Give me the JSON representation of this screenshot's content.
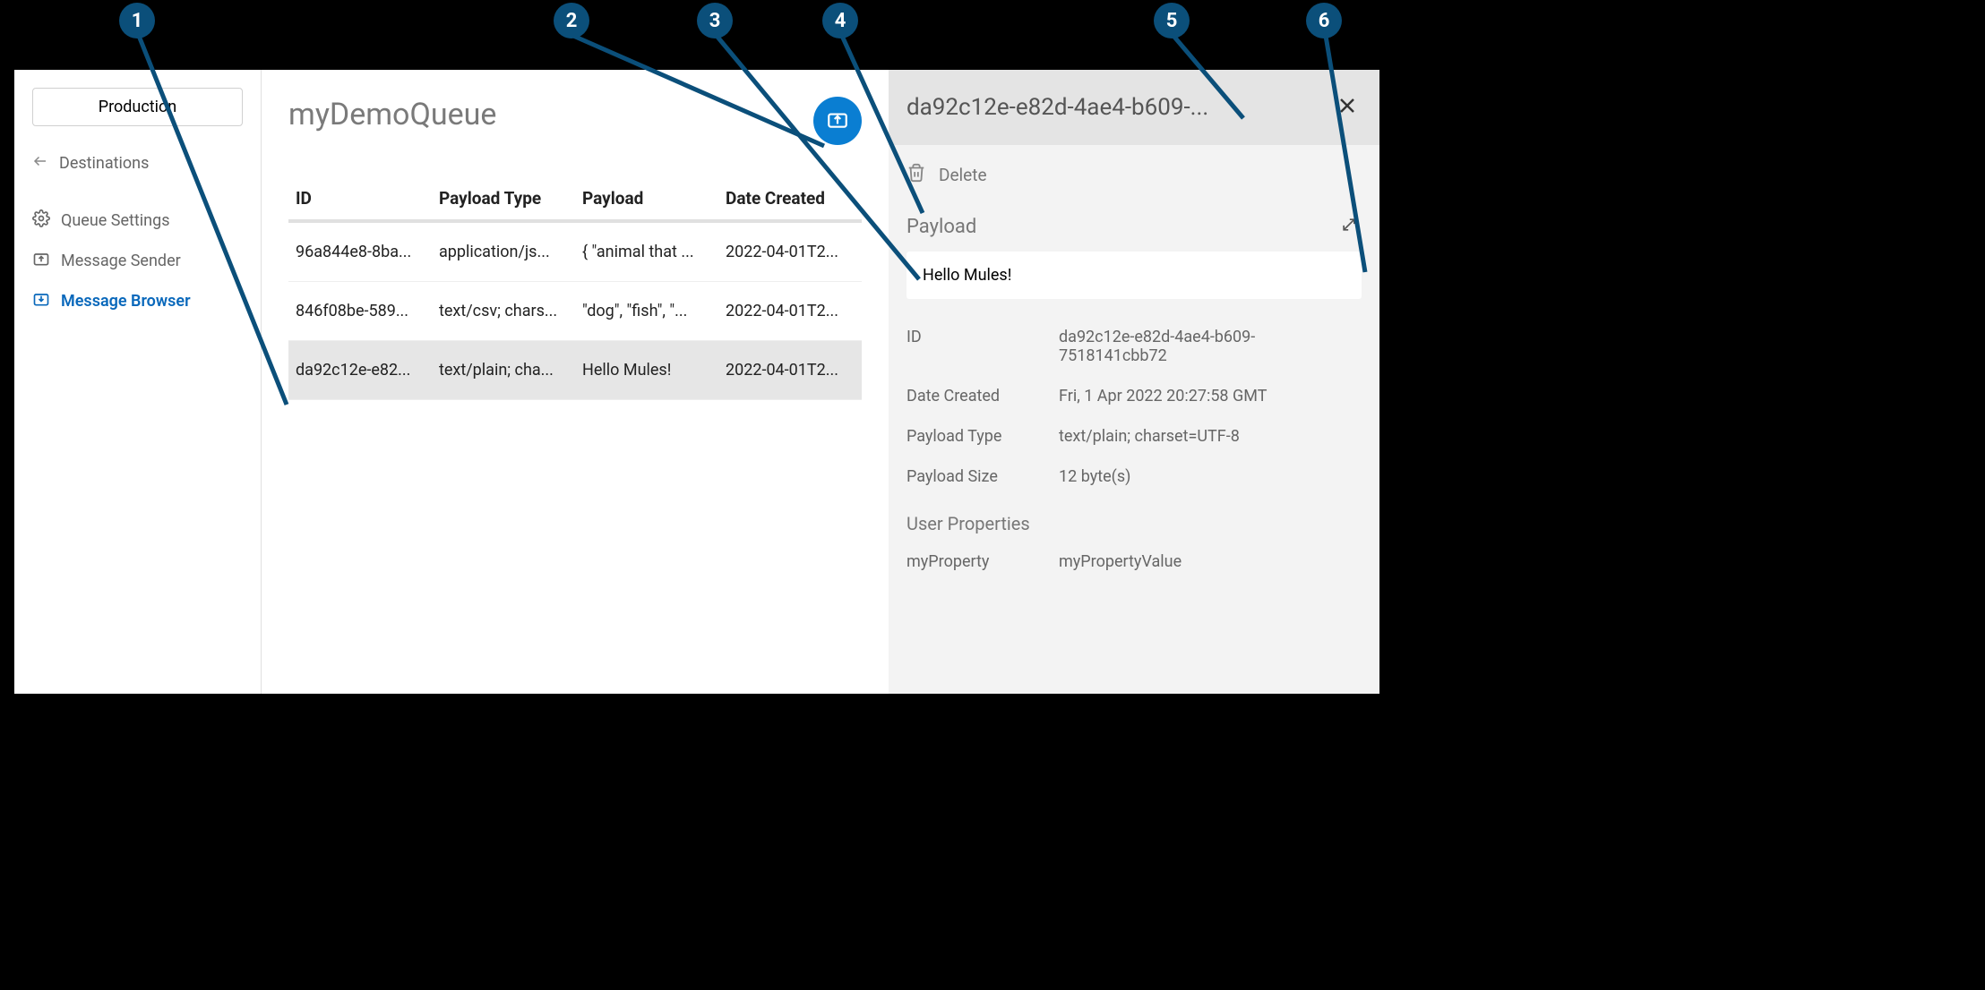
{
  "callouts": [
    "1",
    "2",
    "3",
    "4",
    "5",
    "6"
  ],
  "sidebar": {
    "environment": "Production",
    "back_label": "Destinations",
    "items": [
      {
        "label": "Queue Settings",
        "icon": "gear-icon"
      },
      {
        "label": "Message Sender",
        "icon": "message-send-icon"
      },
      {
        "label": "Message Browser",
        "icon": "message-browse-icon",
        "active": true
      }
    ]
  },
  "main": {
    "queue_name": "myDemoQueue",
    "columns": [
      "ID",
      "Payload Type",
      "Payload",
      "Date Created"
    ],
    "rows": [
      {
        "id": "96a844e8-8ba...",
        "type": "application/js...",
        "payload": "{ \"animal that ...",
        "created": "2022-04-01T2..."
      },
      {
        "id": "846f08be-589...",
        "type": "text/csv; chars...",
        "payload": "\"dog\", \"fish\", \"...",
        "created": "2022-04-01T2..."
      },
      {
        "id": "da92c12e-e82...",
        "type": "text/plain; cha...",
        "payload": "Hello Mules!",
        "created": "2022-04-01T2...",
        "selected": true
      }
    ]
  },
  "detail": {
    "title_truncated": "da92c12e-e82d-4ae4-b609-...",
    "delete_label": "Delete",
    "payload_section": "Payload",
    "payload_value": "Hello Mules!",
    "meta": [
      {
        "key": "ID",
        "value": "da92c12e-e82d-4ae4-b609-7518141cbb72"
      },
      {
        "key": "Date Created",
        "value": "Fri, 1 Apr 2022 20:27:58 GMT"
      },
      {
        "key": "Payload Type",
        "value": "text/plain; charset=UTF-8"
      },
      {
        "key": "Payload Size",
        "value": "12 byte(s)"
      }
    ],
    "user_properties_title": "User Properties",
    "user_properties": [
      {
        "key": "myProperty",
        "value": "myPropertyValue"
      }
    ]
  }
}
